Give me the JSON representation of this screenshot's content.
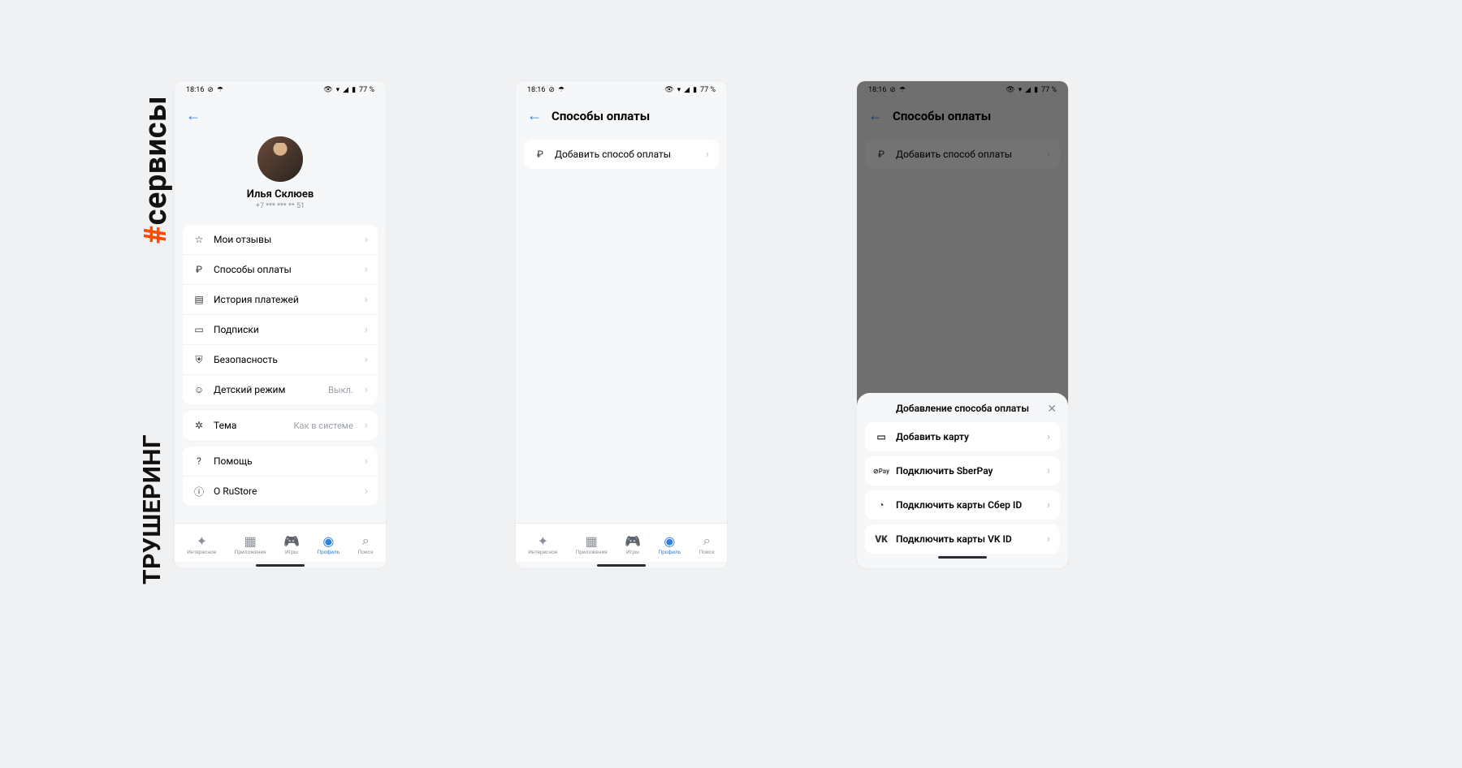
{
  "hashtags": {
    "top_hash": "#",
    "top": "сервисы",
    "bottom": "ТРУШЕРИНГ"
  },
  "status": {
    "time": "18:16",
    "battery": "77 %"
  },
  "screen1": {
    "profile_name": "Илья Склюев",
    "profile_phone": "+7 *** *** ** 51",
    "groups": [
      [
        {
          "icon": "star",
          "label": "Мои отзывы"
        },
        {
          "icon": "ruble",
          "label": "Способы оплаты"
        },
        {
          "icon": "receipt",
          "label": "История платежей"
        },
        {
          "icon": "subs",
          "label": "Подписки"
        },
        {
          "icon": "shield",
          "label": "Безопасность"
        },
        {
          "icon": "kids",
          "label": "Детский режим",
          "value": "Выкл."
        }
      ],
      [
        {
          "icon": "theme",
          "label": "Тема",
          "value": "Как в системе"
        }
      ],
      [
        {
          "icon": "help",
          "label": "Помощь"
        },
        {
          "icon": "info",
          "label": "О RuStore"
        }
      ]
    ]
  },
  "screen2": {
    "title": "Способы оплаты",
    "row_label": "Добавить способ оплаты"
  },
  "screen3": {
    "title": "Способы оплаты",
    "row_label": "Добавить способ оплаты",
    "sheet_title": "Добавление способа оплаты",
    "options": [
      {
        "icon": "card",
        "label": "Добавить карту"
      },
      {
        "icon": "sberpay",
        "label": "Подключить SberPay"
      },
      {
        "icon": "sberid",
        "label": "Подключить карты Сбер ID"
      },
      {
        "icon": "vk",
        "label": "Подключить карты VK ID"
      }
    ]
  },
  "nav": {
    "items": [
      {
        "label": "Интересное"
      },
      {
        "label": "Приложения"
      },
      {
        "label": "Игры"
      },
      {
        "label": "Профиль",
        "active": true
      },
      {
        "label": "Поиск"
      }
    ]
  }
}
